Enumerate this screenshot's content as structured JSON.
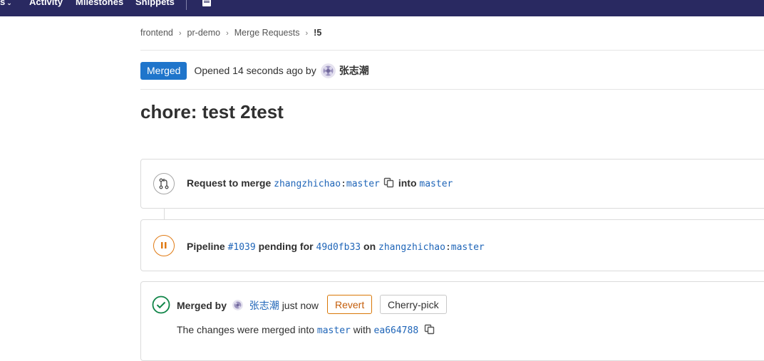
{
  "topnav": {
    "partial_item": "s",
    "activity": "Activity",
    "milestones": "Milestones",
    "snippets": "Snippets"
  },
  "breadcrumb": {
    "group": "frontend",
    "project": "pr-demo",
    "section": "Merge Requests",
    "current": "!5"
  },
  "status": {
    "badge": "Merged",
    "opened_text": "Opened 14 seconds ago by",
    "author": "张志潮"
  },
  "title": "chore: test 2test",
  "request_to_merge": {
    "label": "Request to merge",
    "source_namespace": "zhangzhichao",
    "colon": ":",
    "source_branch": "master",
    "into_label": "into",
    "target_branch": "master"
  },
  "pipeline": {
    "label": "Pipeline",
    "id": "#1039",
    "status_text": "pending for",
    "commit": "49d0fb33",
    "on_label": "on",
    "namespace": "zhangzhichao",
    "colon": ":",
    "branch": "master"
  },
  "merged": {
    "label": "Merged by",
    "user": "张志潮",
    "time": "just now",
    "revert_button": "Revert",
    "cherry_pick_button": "Cherry-pick",
    "info_prefix": "The changes were merged into",
    "target_branch": "master",
    "with_label": "with",
    "commit": "ea664788"
  },
  "colors": {
    "nav_bg": "#292961",
    "merged_badge": "#1f75cb",
    "pipeline_pending": "#e07b15",
    "success": "#108548",
    "link": "#1f65b8"
  }
}
